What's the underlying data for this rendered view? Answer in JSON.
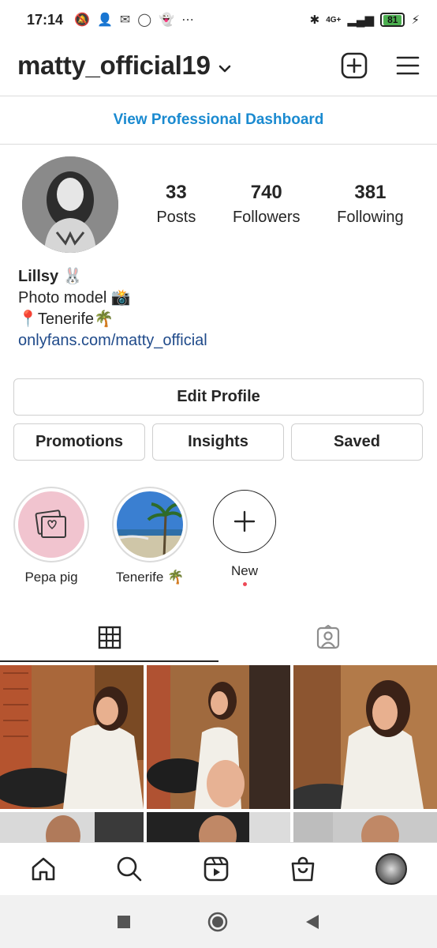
{
  "status_bar": {
    "time": "17:14",
    "network": "4G+",
    "battery": "81"
  },
  "header": {
    "username": "matty_official19"
  },
  "dashboard": {
    "label": "View Professional Dashboard"
  },
  "profile": {
    "stats": [
      {
        "value": "33",
        "label": "Posts"
      },
      {
        "value": "740",
        "label": "Followers"
      },
      {
        "value": "381",
        "label": "Following"
      }
    ],
    "bio": {
      "name": "Lillsy 🐰",
      "line1": "Photo model 📸",
      "line2": "📍Tenerife🌴",
      "link": "onlyfans.com/matty_official"
    }
  },
  "buttons": {
    "edit_profile": "Edit Profile",
    "promotions": "Promotions",
    "insights": "Insights",
    "saved": "Saved"
  },
  "highlights": [
    {
      "label": "Pepa pig"
    },
    {
      "label": "Tenerife 🌴"
    },
    {
      "label": "New"
    }
  ],
  "colors": {
    "accent_blue": "#1a8ad0",
    "link_blue": "#1f4a8a",
    "text": "#262626",
    "border": "#dbdbdb",
    "notification_dot": "#ed4956",
    "battery_green": "#4caf50"
  },
  "icons": {
    "header": [
      "chevron-down-icon",
      "add-post-icon",
      "menu-icon"
    ],
    "tabs": [
      "grid-icon",
      "tagged-icon"
    ],
    "bottom_nav": [
      "home-icon",
      "search-icon",
      "reels-icon",
      "shop-icon",
      "profile-avatar"
    ],
    "system_nav": [
      "recents-icon",
      "home-circle-icon",
      "back-icon"
    ]
  }
}
